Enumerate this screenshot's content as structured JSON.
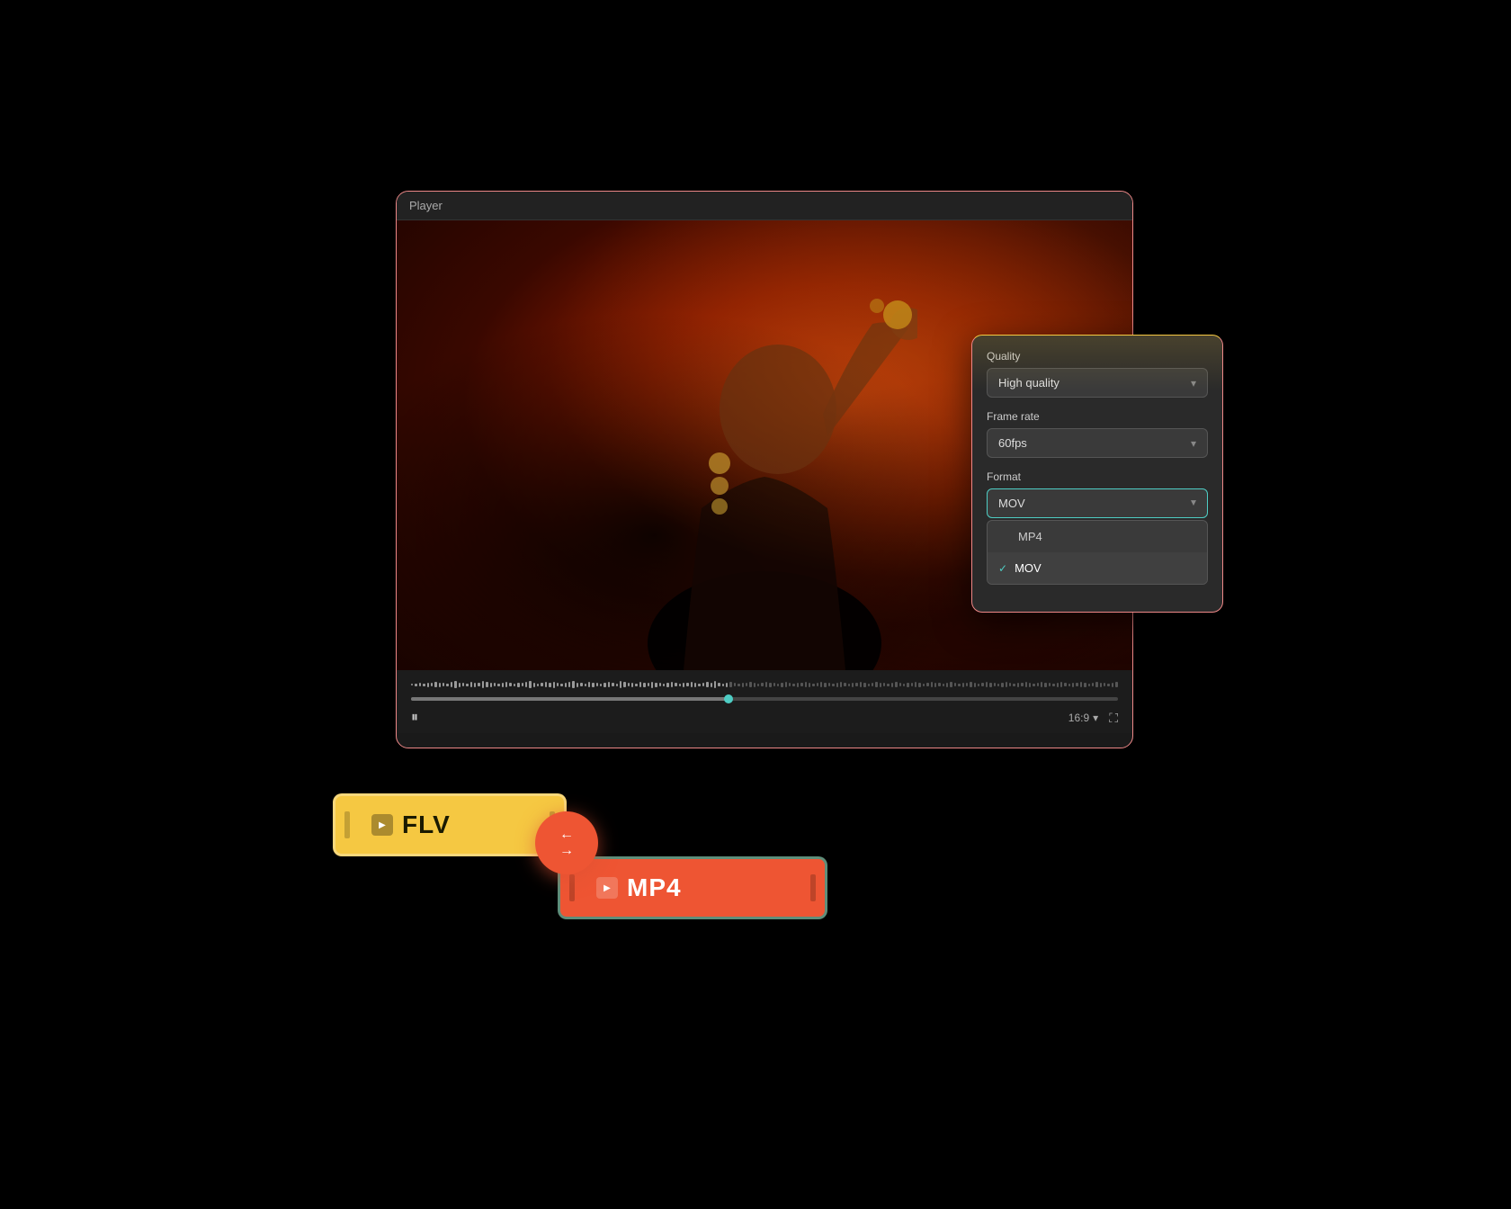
{
  "player": {
    "title": "Player",
    "aspect_ratio": "16:9",
    "timeline_progress": 45,
    "controls": {
      "pause_icon": "⏸",
      "fullscreen_icon": "⛶",
      "aspect_ratio_label": "16:9",
      "chevron": "▾"
    }
  },
  "settings": {
    "quality": {
      "label": "Quality",
      "value": "High quality",
      "chevron": "▾"
    },
    "frame_rate": {
      "label": "Frame rate",
      "value": "60fps",
      "chevron": "▾"
    },
    "format": {
      "label": "Format",
      "value": "MOV",
      "chevron": "▴",
      "options": [
        {
          "label": "MP4",
          "selected": false
        },
        {
          "label": "MOV",
          "selected": true
        }
      ]
    }
  },
  "format_badges": {
    "input": {
      "label": "FLV",
      "icon": "▶"
    },
    "output": {
      "label": "MP4",
      "icon": "▶"
    }
  },
  "convert_button": {
    "arrows": "⇄"
  },
  "colors": {
    "flv_bg": "#f5c842",
    "mp4_bg": "#e04433",
    "convert_bg": "#e04433",
    "panel_border_top": "#f5c842",
    "panel_border": "#e88888",
    "active_border": "#4ecdc4",
    "check_color": "#4ecdc4"
  }
}
